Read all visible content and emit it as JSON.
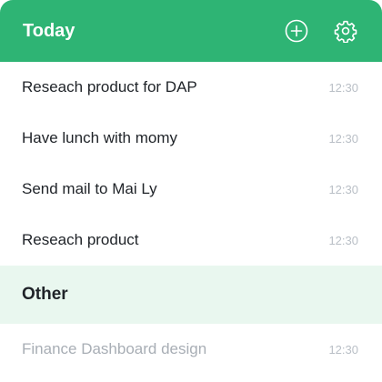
{
  "colors": {
    "accent": "#2eb474",
    "section_bg": "#e9f7ef"
  },
  "header": {
    "title": "Today",
    "add_icon": "plus-circle-icon",
    "settings_icon": "gear-icon"
  },
  "today": [
    {
      "title": "Reseach product for DAP",
      "time": "12:30"
    },
    {
      "title": "Have lunch with momy",
      "time": "12:30"
    },
    {
      "title": "Send mail to Mai Ly",
      "time": "12:30"
    },
    {
      "title": "Reseach product",
      "time": "12:30"
    }
  ],
  "other": {
    "title": "Other",
    "items": [
      {
        "title": "Finance Dashboard design",
        "time": "12:30"
      }
    ]
  }
}
